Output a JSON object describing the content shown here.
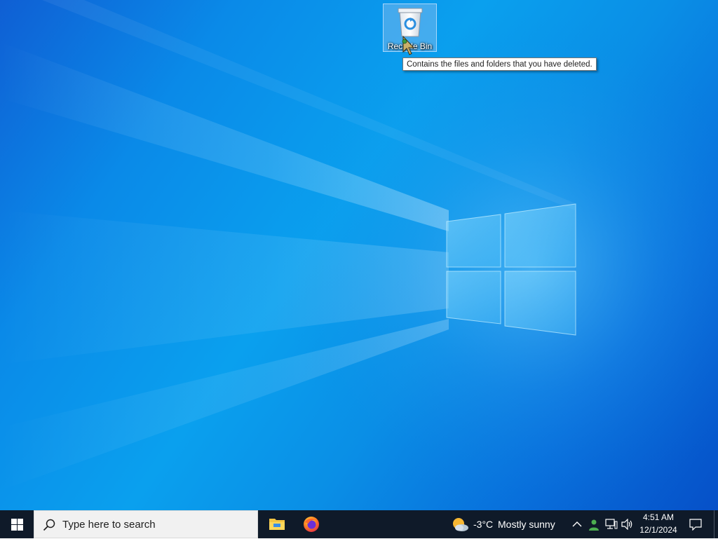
{
  "desktop": {
    "icons": [
      {
        "label": "Recycle Bin",
        "icon": "recycle-bin-icon"
      }
    ],
    "tooltip": "Contains the files and folders that you have deleted."
  },
  "taskbar": {
    "start_icon": "windows-logo-icon",
    "search": {
      "placeholder": "Type here to search",
      "icon": "search-icon"
    },
    "pinned_apps": [
      {
        "name": "File Explorer",
        "icon": "folder-icon"
      },
      {
        "name": "Firefox",
        "icon": "firefox-icon"
      }
    ],
    "weather": {
      "temperature": "-3°C",
      "condition": "Mostly sunny",
      "icon": "partly-sunny-icon"
    },
    "tray": {
      "icons": [
        "chevron-up-icon",
        "people-icon",
        "network-icon",
        "volume-icon"
      ]
    },
    "clock": {
      "time": "4:51 AM",
      "date": "12/1/2024"
    },
    "notification_icon": "notification-icon"
  },
  "colors": {
    "taskbar": "#0f1a29",
    "wallpaper_blue": "#0a8ae8",
    "search_bg": "#f1f1f1",
    "active_indicator": "#76b9ed"
  }
}
